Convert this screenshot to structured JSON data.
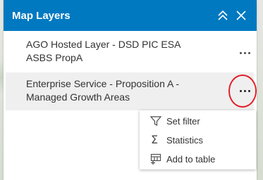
{
  "panel": {
    "title": "Map Layers",
    "header_icons": [
      "chevrons-up-icon",
      "close-icon"
    ],
    "accent_color": "#0079c1"
  },
  "layers": [
    {
      "name": "AGO Hosted Layer - DSD PIC ESA ASBS PropA",
      "line1": "AGO Hosted Layer - DSD PIC ESA",
      "line2": "ASBS PropA"
    },
    {
      "name": "Enterprise Service - Proposition A - Managed Growth Areas",
      "line1": "Enterprise Service - Proposition A -",
      "line2": "Managed Growth Areas"
    }
  ],
  "menu": {
    "items": [
      {
        "label": "Set filter",
        "icon": "filter-icon"
      },
      {
        "label": "Statistics",
        "icon": "sigma-icon"
      },
      {
        "label": "Add to table",
        "icon": "add-table-icon"
      }
    ]
  },
  "annotation_color": "#e3202a"
}
